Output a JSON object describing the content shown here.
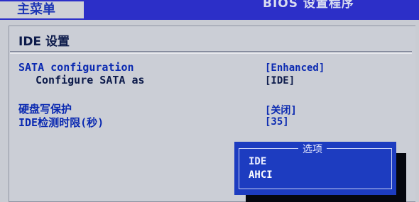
{
  "header": {
    "main_tab": "主菜单",
    "bios_title": "BIOS 设置程序"
  },
  "section": {
    "title": "IDE 设置"
  },
  "settings": [
    {
      "label": "SATA configuration",
      "value": "[Enhanced]"
    },
    {
      "label": "Configure SATA as",
      "value": "[IDE]"
    },
    {
      "label": "硬盘写保护",
      "value": "[关闭]"
    },
    {
      "label": "IDE检测时限(秒)",
      "value": "[35]"
    }
  ],
  "popup": {
    "title": "选项",
    "options": [
      "IDE",
      "AHCI"
    ]
  },
  "colors": {
    "header_bar": "#2c2fc8",
    "panel_bg": "#cbced6",
    "accent_blue": "#0b2ab1",
    "popup_bg": "#1d3cc0"
  }
}
